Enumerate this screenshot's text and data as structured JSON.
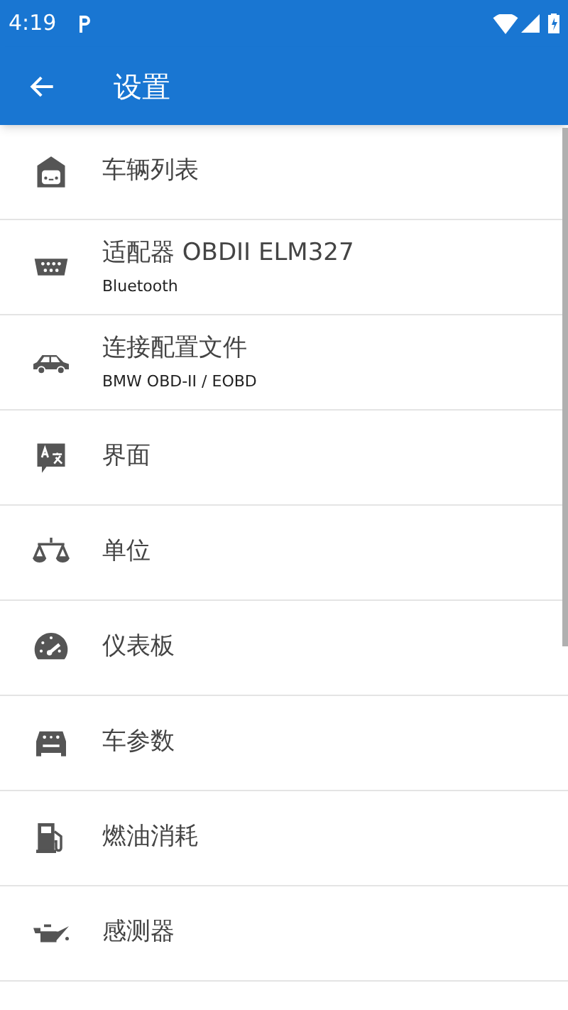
{
  "status_bar": {
    "time": "4:19"
  },
  "toolbar": {
    "title": "设置"
  },
  "items": [
    {
      "title": "车辆列表"
    },
    {
      "title": "适配器 OBDII ELM327",
      "subtitle": "Bluetooth"
    },
    {
      "title": "连接配置文件",
      "subtitle": "BMW OBD-II / EOBD"
    },
    {
      "title": "界面"
    },
    {
      "title": "单位"
    },
    {
      "title": "仪表板"
    },
    {
      "title": "车参数"
    },
    {
      "title": "燃油消耗"
    },
    {
      "title": "感测器"
    }
  ]
}
